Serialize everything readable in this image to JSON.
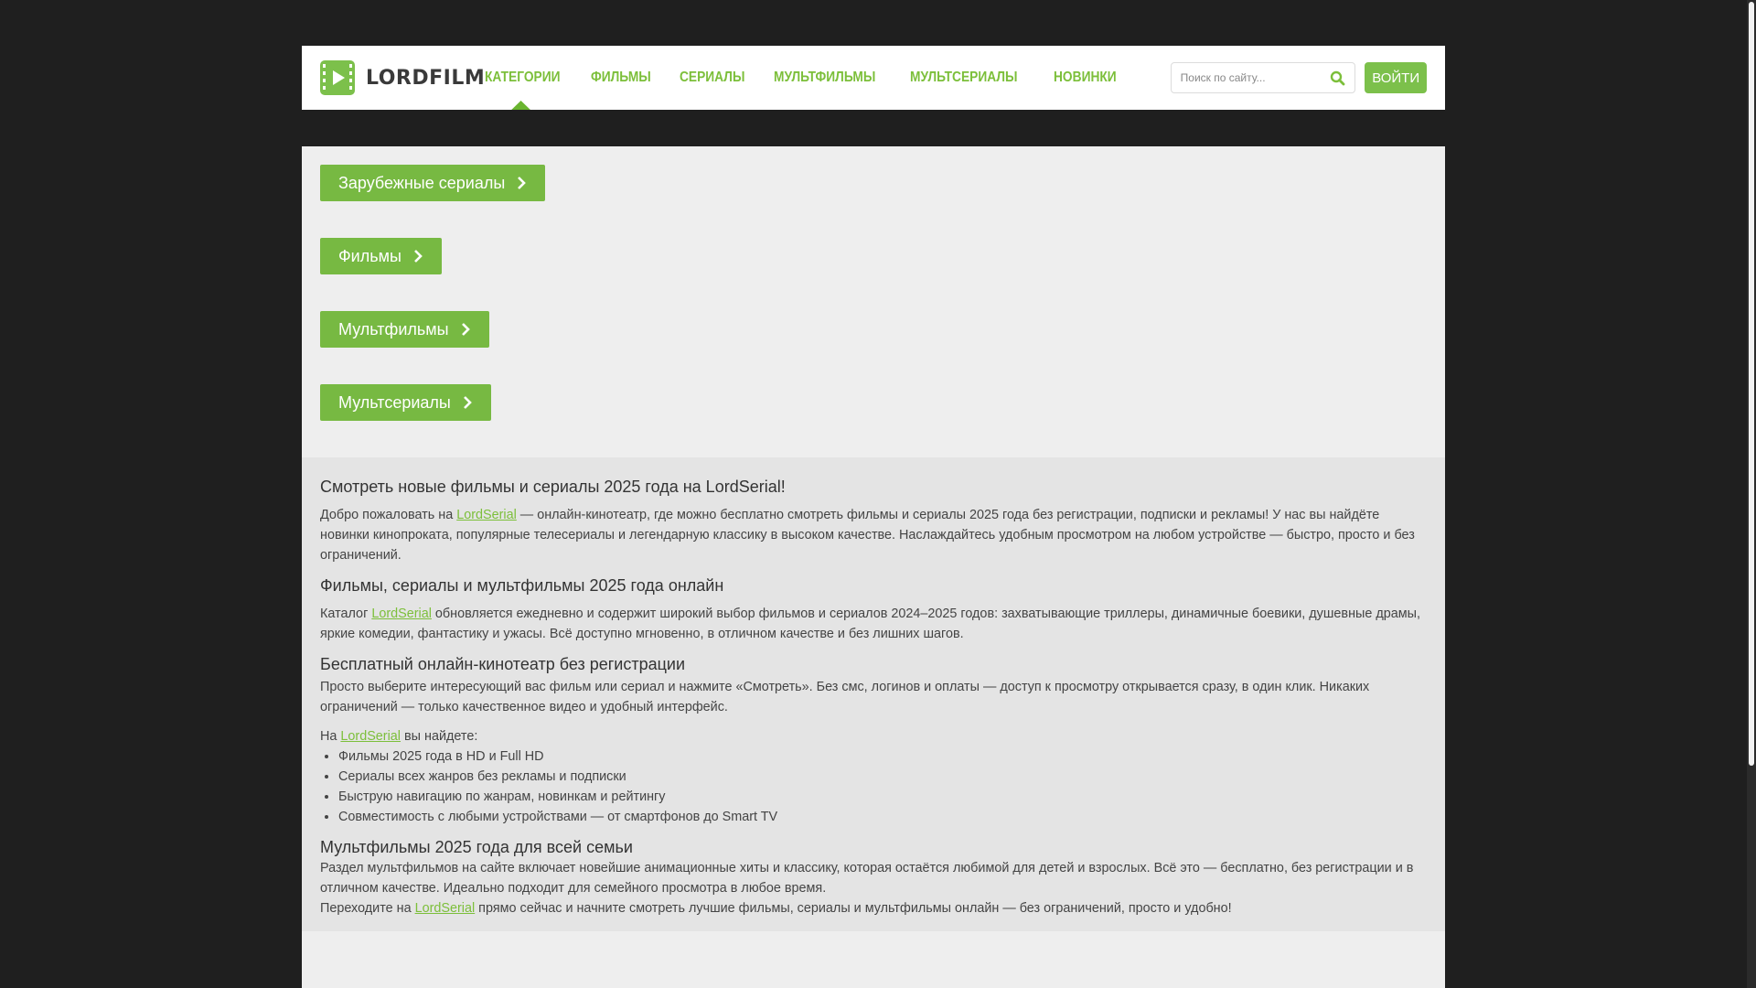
{
  "header": {
    "logo_text": "LORDFILM",
    "nav": [
      "КАТЕГОРИИ",
      "ФИЛЬМЫ",
      "СЕРИАЛЫ",
      "МУЛЬТФИЛЬМЫ",
      "МУЛЬТСЕРИАЛЫ",
      "НОВИНКИ"
    ],
    "search_placeholder": "Поиск по сайту...",
    "login_label": "ВОЙТИ"
  },
  "categories": [
    "Зарубежные сериалы",
    "Фильмы",
    "Мультфильмы",
    "Мультсериалы"
  ],
  "info": {
    "h1": "Смотреть новые фильмы и сериалы 2025 года на LordSerial!",
    "p1_before": "Добро пожаловать на ",
    "link": "LordSerial",
    "p1_after": " — онлайн-кинотеатр, где можно бесплатно смотреть фильмы и сериалы 2025 года без регистрации, подписки и рекламы! У нас вы найдёте новинки кинопроката, популярные телесериалы и легендарную классику в высоком качестве. Наслаждайтесь удобным просмотром на любом устройстве — быстро, просто и без ограничений.",
    "h2": "Фильмы, сериалы и мультфильмы 2025 года онлайн",
    "p2_before": "Каталог ",
    "p2_after": " обновляется ежедневно и содержит широкий выбор фильмов и сериалов 2024–2025 годов: захватывающие триллеры, динамичные боевики, душевные драмы, яркие комедии, фантастику и ужасы. Всё доступно мгновенно, в отличном качестве и без лишних шагов.",
    "h3": "Бесплатный онлайн-кинотеатр без регистрации",
    "p3": "Просто выберите интересующий вас фильм или сериал и нажмите «Смотреть». Без смс, логинов и оплаты — доступ к просмотру открывается сразу, в один клик. Никаких ограничений — только качественное видео и удобный интерфейс.",
    "p4_before": "На ",
    "p4_after": " вы найдете:",
    "list": [
      "Фильмы 2025 года в HD и Full HD",
      "Сериалы всех жанров без рекламы и подписки",
      "Быструю навигацию по жанрам, новинкам и рейтингу",
      "Совместимость с любыми устройствами — от смартфонов до Smart TV"
    ],
    "h4": "Мультфильмы 2025 года для всей семьи",
    "p5": "Раздел мультфильмов на сайте включает новейшие анимационные хиты и классику, которая остаётся любимой для детей и взрослых. Всё это — бесплатно, без регистрации и в отличном качестве. Идеально подходит для семейного просмотра в любое время.",
    "p6_before": "Переходите на ",
    "p6_after": " прямо сейчас и начните смотреть лучшие фильмы, сериалы и мультфильмы онлайн — без ограничений, просто и удобно!"
  },
  "colors": {
    "accent": "#7cbf3a",
    "button": "#77b942"
  }
}
